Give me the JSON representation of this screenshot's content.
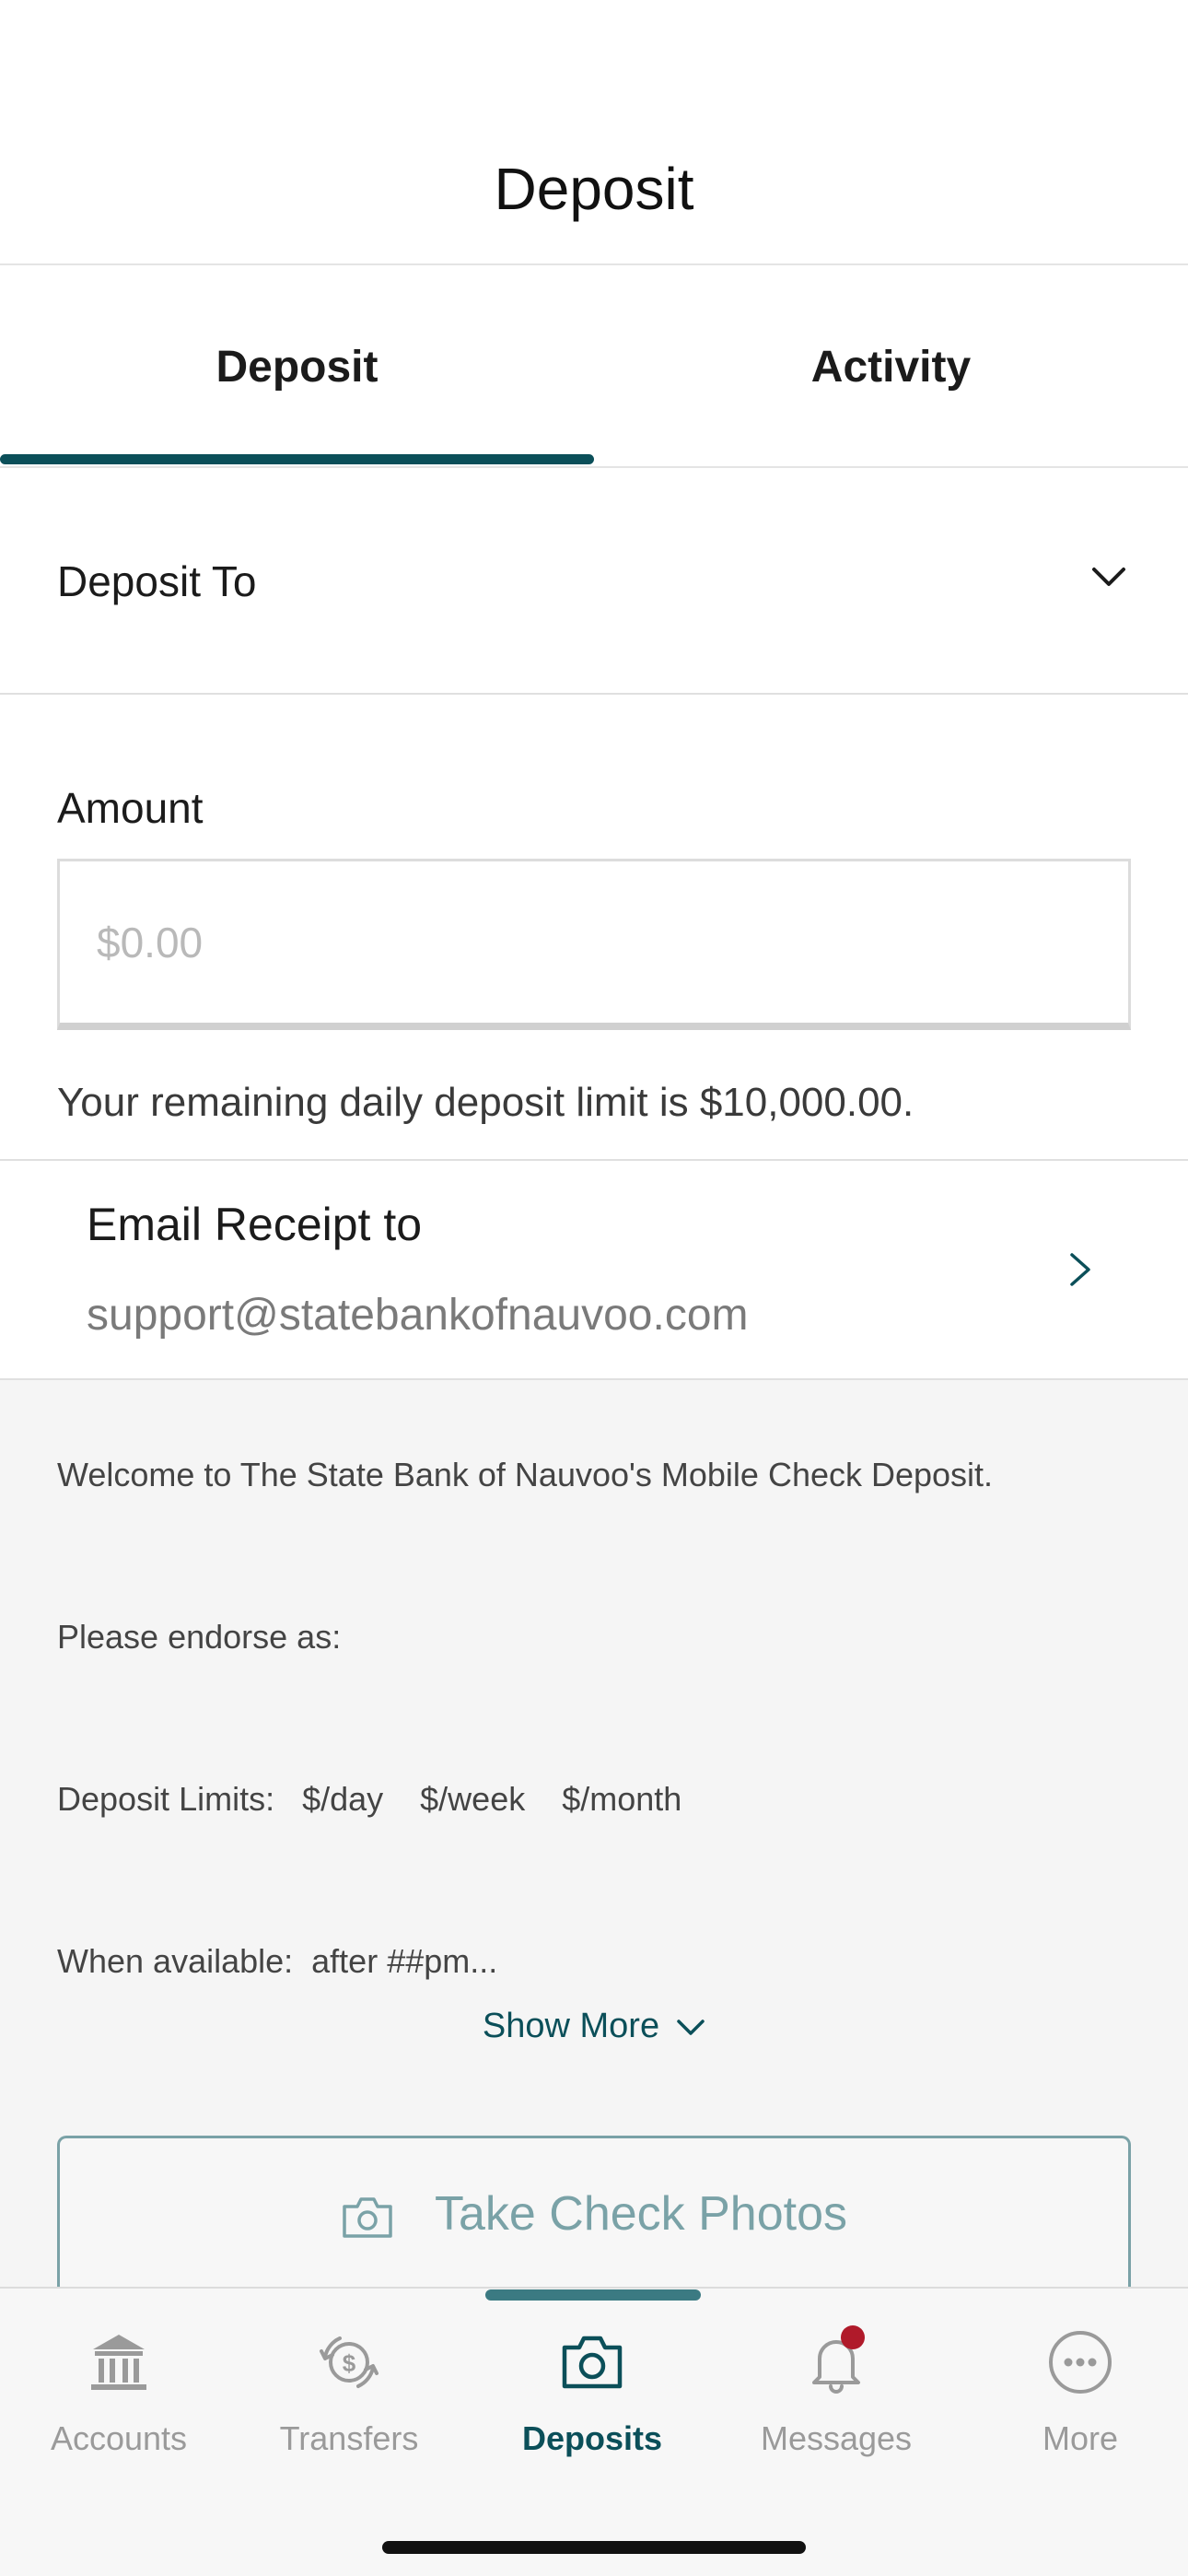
{
  "header": {
    "title": "Deposit"
  },
  "tabs": [
    {
      "label": "Deposit",
      "active": true
    },
    {
      "label": "Activity",
      "active": false
    }
  ],
  "form": {
    "deposit_to_label": "Deposit To",
    "amount_label": "Amount",
    "amount_placeholder": "$0.00",
    "amount_value": "",
    "limit_text": "Your remaining daily deposit limit is $10,000.00."
  },
  "email_receipt": {
    "label": "Email Receipt to",
    "value": "support@statebankofnauvoo.com"
  },
  "info": {
    "lines": [
      "Welcome to The State Bank of Nauvoo's Mobile Check Deposit.",
      "Please endorse as:",
      "Deposit Limits:   $/day    $/week    $/month",
      "When available:  after ##pm..."
    ],
    "show_more_label": "Show More"
  },
  "check_button": {
    "label": "Take Check Photos",
    "icon": "camera-icon"
  },
  "bottom_nav": {
    "items": [
      {
        "label": "Accounts",
        "icon": "bank-icon",
        "active": false
      },
      {
        "label": "Transfers",
        "icon": "transfer-icon",
        "active": false
      },
      {
        "label": "Deposits",
        "icon": "camera-icon",
        "active": true
      },
      {
        "label": "Messages",
        "icon": "bell-icon",
        "active": false,
        "badge": true
      },
      {
        "label": "More",
        "icon": "more-icon",
        "active": false
      }
    ]
  },
  "colors": {
    "accent": "#0b4f59",
    "accent_light": "#7aa2a7",
    "badge": "#b01a2a",
    "inactive": "#9a9a9a",
    "panel_bg": "#f5f5f5"
  }
}
